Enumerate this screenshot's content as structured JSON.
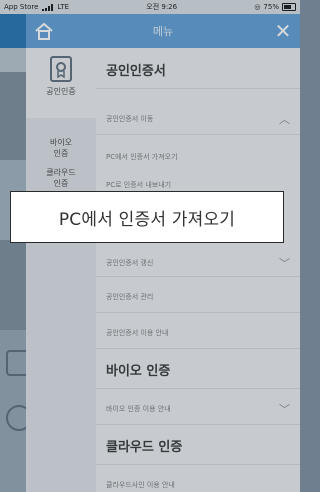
{
  "status_bar": {
    "carrier": "App Store",
    "network": "LTE",
    "time": "오전 9:26",
    "battery": "75%"
  },
  "drawer": {
    "title": "메뉴",
    "side_nav": [
      {
        "label": "공인인증"
      },
      {
        "label": "바이오\n인증"
      },
      {
        "label": "클라우드\n인증"
      }
    ],
    "sections": [
      {
        "title": "공인인증서",
        "items": [
          {
            "label": "공인인증서 이동"
          },
          {
            "label": "PC에서 인증서 가져오기"
          },
          {
            "label": "PC로 인증서 내보내기"
          },
          {
            "label": "공인인증서 갱신"
          },
          {
            "label": "공인인증서 관리"
          },
          {
            "label": "공인인증서 이용 안내"
          }
        ]
      },
      {
        "title": "바이오 인증",
        "items": [
          {
            "label": "바이오 인증 이용 안내"
          }
        ]
      },
      {
        "title": "클라우드 인증",
        "items": [
          {
            "label": "클라우드사인 이용 안내"
          }
        ]
      }
    ]
  },
  "caption": {
    "text": "PC에서 인증서 가져오기"
  },
  "colors": {
    "header_blue": "#5b9bd5",
    "drawer_bg": "#eceef1"
  }
}
